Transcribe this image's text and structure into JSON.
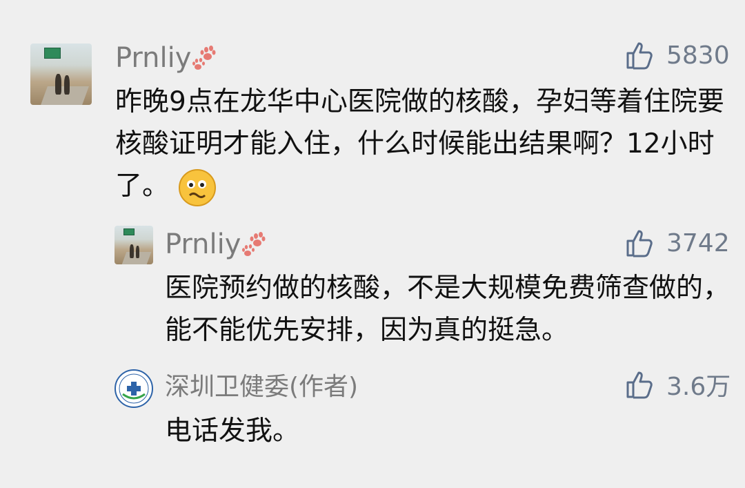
{
  "comments": [
    {
      "username": "Prnliy",
      "likes": "5830",
      "text": "昨晚9点在龙华中心医院做的核酸，孕妇等着住院要核酸证明才能入住，什么时候能出结果啊？12小时了。"
    },
    {
      "username": "Prnliy",
      "likes": "3742",
      "text": "医院预约做的核酸，不是大规模免费筛查做的，能不能优先安排，因为真的挺急。"
    },
    {
      "username": "深圳卫健委(作者)",
      "likes": "3.6万",
      "text": "电话发我。"
    }
  ],
  "icons": {
    "like": "thumbs-up-icon",
    "decoration": "paw-icon",
    "emoji": "worried-face-emoji"
  },
  "colors": {
    "background": "#efefef",
    "username": "#7b7b7b",
    "like": "#6f7a8a",
    "text": "#111111"
  }
}
